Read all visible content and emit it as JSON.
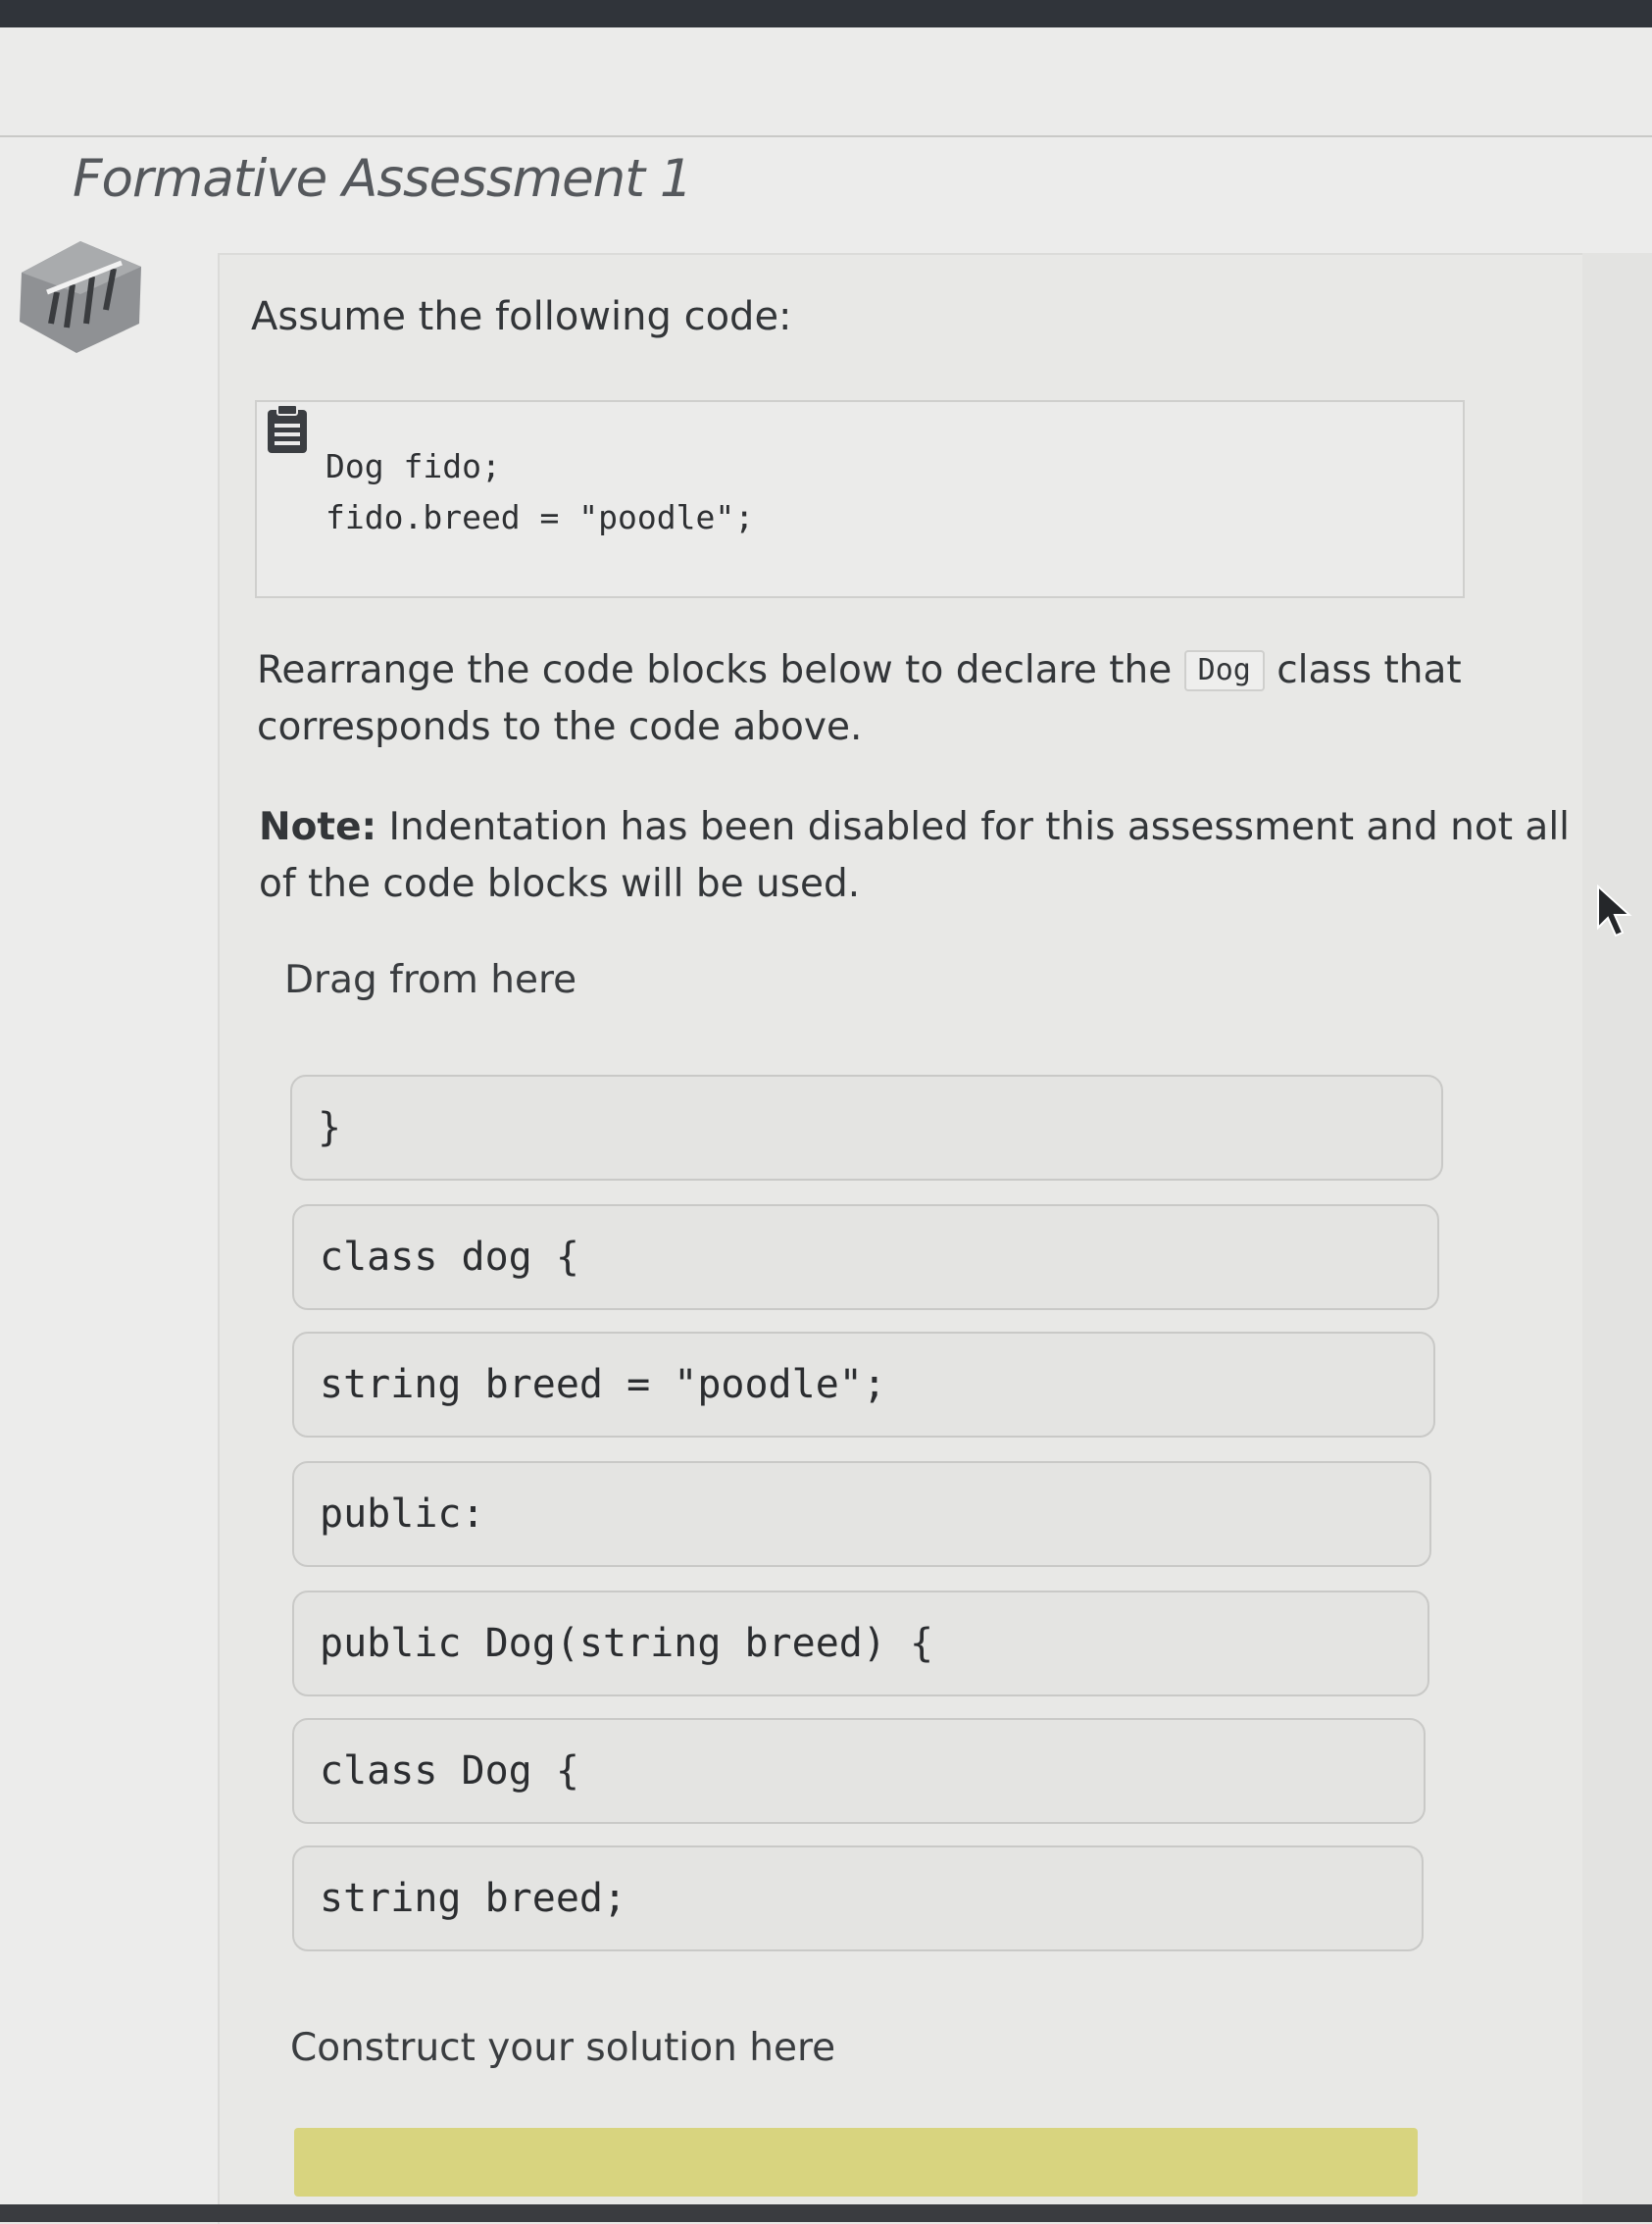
{
  "page": {
    "title": "Formative Assessment 1"
  },
  "question": {
    "prompt": "Assume the following code:",
    "code_lines": [
      "Dog fido;",
      "fido.breed = \"poodle\";"
    ],
    "instruction_part1": "Rearrange the code blocks below to declare the",
    "instruction_code": "Dog",
    "instruction_part2": "class that",
    "instruction_line2": "corresponds to the code above.",
    "note_label": "Note:",
    "note_part1": "Indentation has been disabled for this assessment and not all",
    "note_line2": "of the code blocks will be used."
  },
  "drag_area": {
    "label": "Drag from here",
    "blocks": [
      "}",
      "class dog {",
      "string breed = \"poodle\";",
      "public:",
      "public Dog(string breed) {",
      "class Dog {",
      "string breed;"
    ]
  },
  "solution_area": {
    "label": "Construct your solution here"
  },
  "icons": {
    "badge": "assessment-badge-icon",
    "clipboard": "clipboard-icon",
    "cursor": "mouse-pointer-icon"
  },
  "colors": {
    "drop_zone": "#d8d47f",
    "background": "#ececeb"
  }
}
